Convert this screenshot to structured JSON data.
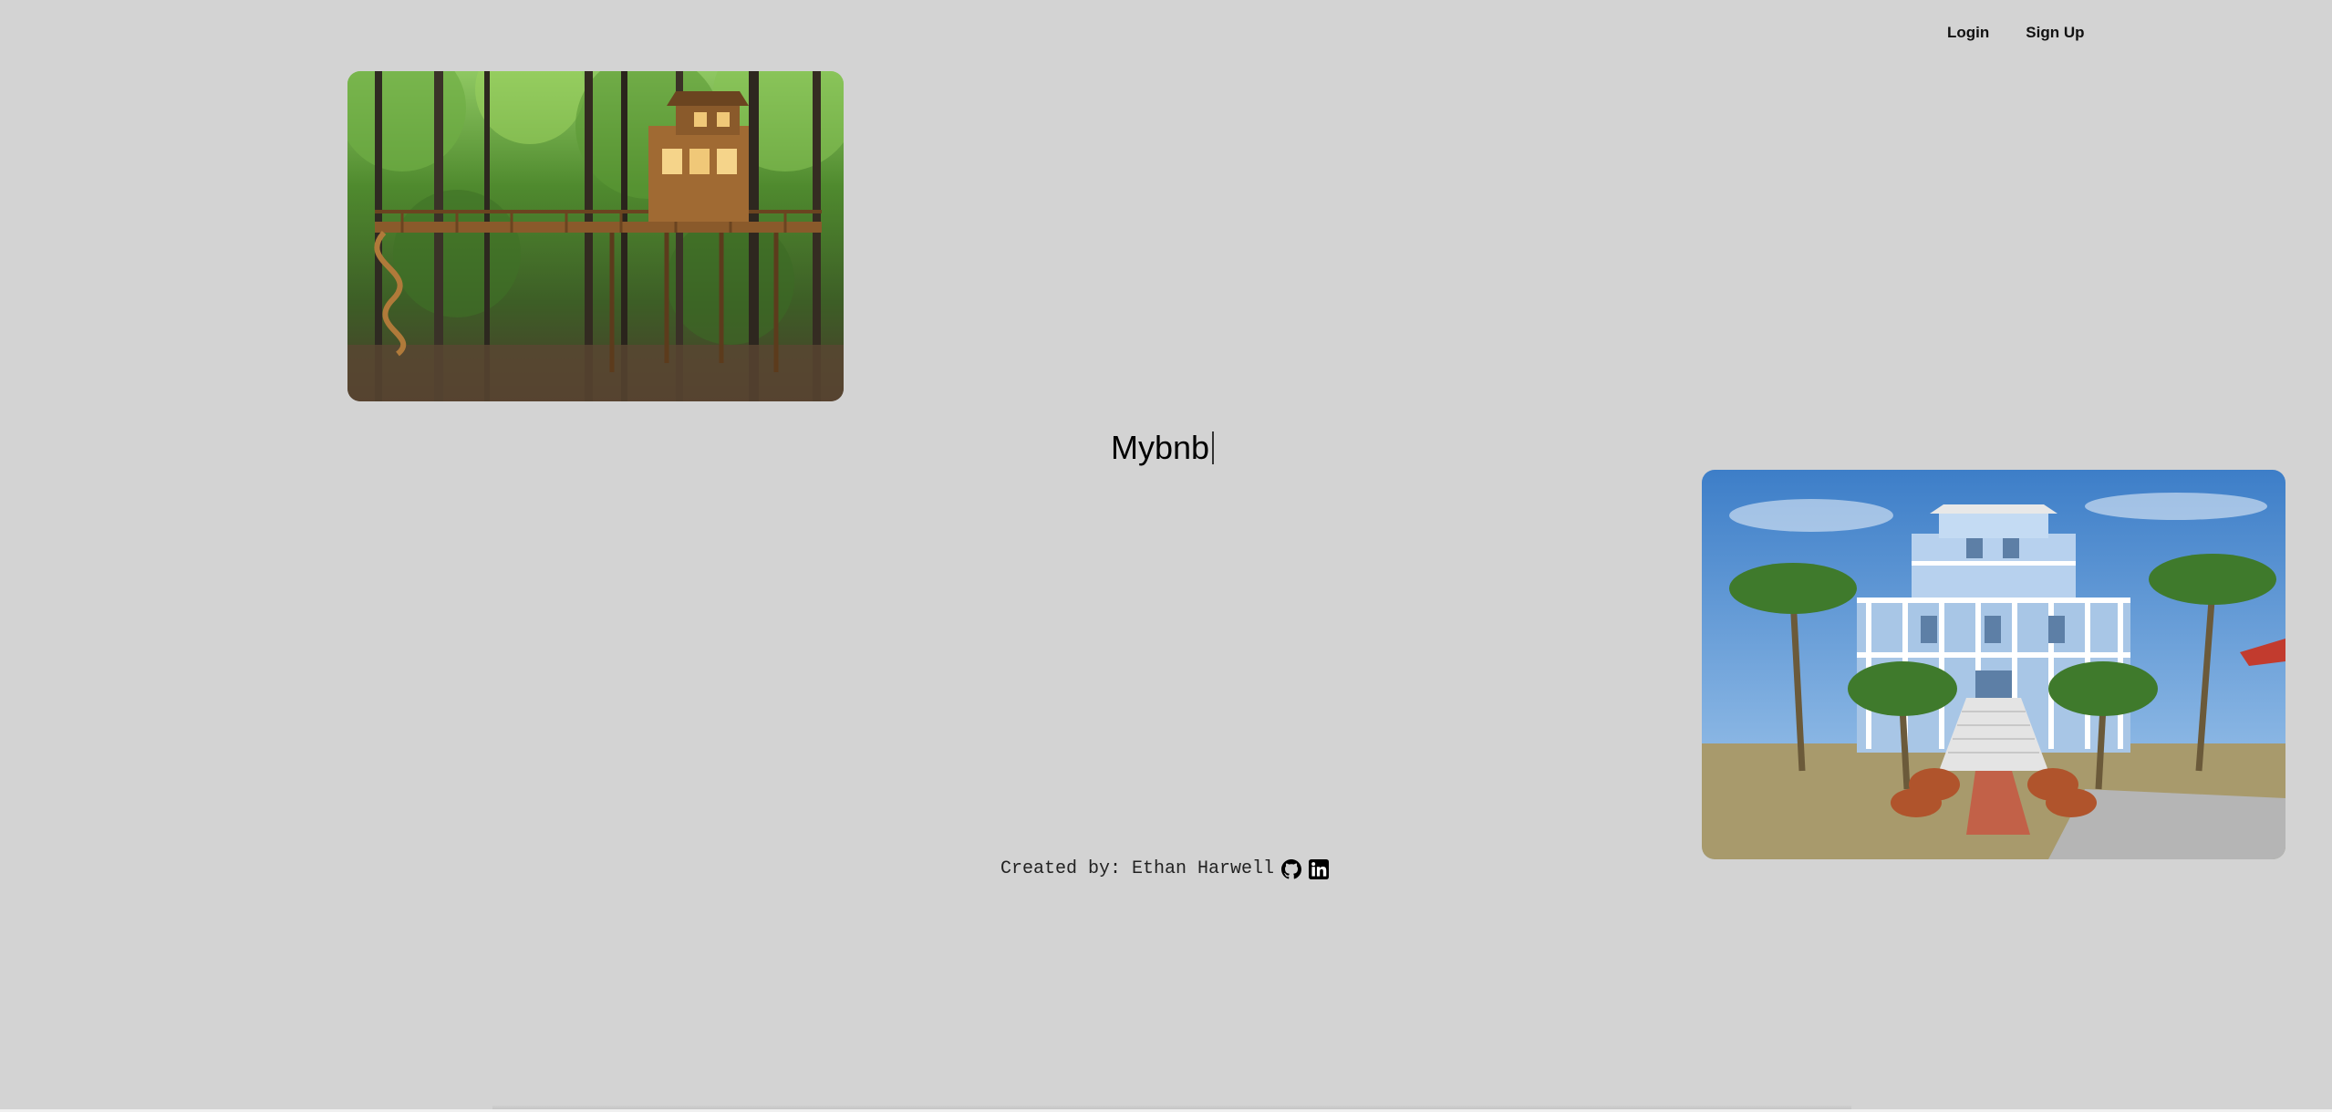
{
  "nav": {
    "login_label": "Login",
    "signup_label": "Sign Up"
  },
  "main": {
    "title": "Mybnb"
  },
  "footer": {
    "credit": "Created by: Ethan Harwell",
    "icons": [
      "github-icon",
      "linkedin-icon"
    ]
  },
  "colors": {
    "background": "#d3d3d3",
    "text": "#111111"
  }
}
